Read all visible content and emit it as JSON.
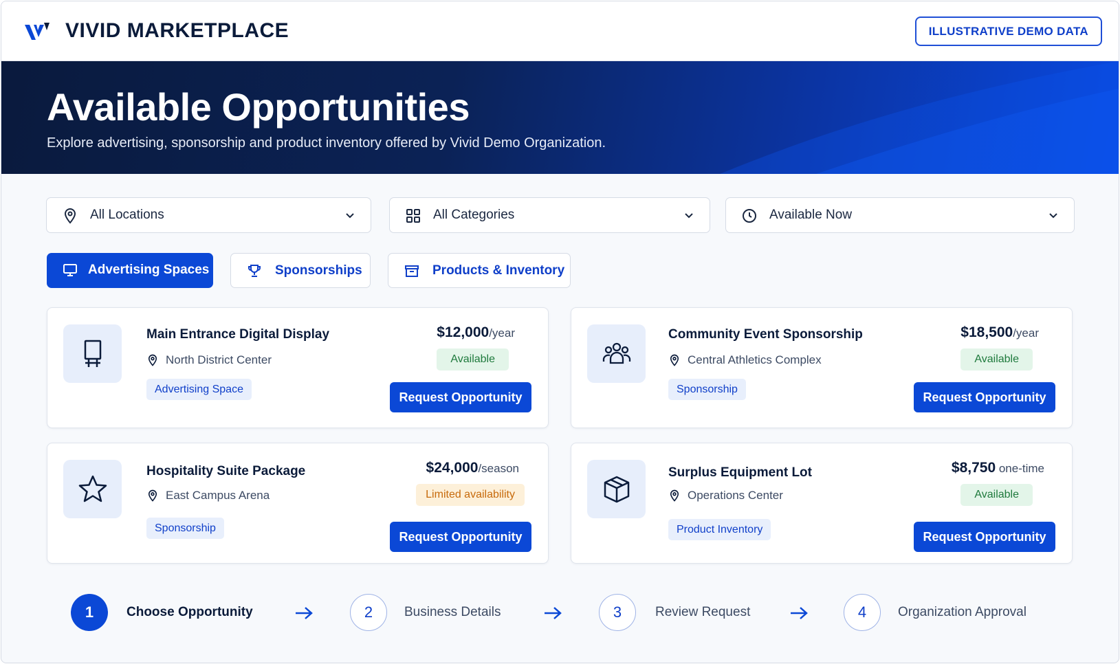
{
  "header": {
    "brand": "VIVID MARKETPLACE",
    "badge": "ILLUSTRATIVE DEMO DATA"
  },
  "hero": {
    "title": "Available Opportunities",
    "subtitle": "Explore advertising, sponsorship and product inventory offered by Vivid Demo Organization."
  },
  "filters": {
    "location": "All Locations",
    "category": "All Categories",
    "availability": "Available Now"
  },
  "tabs": [
    {
      "label": "Advertising Spaces",
      "active": true
    },
    {
      "label": "Sponsorships",
      "active": false
    },
    {
      "label": "Products & Inventory",
      "active": false
    }
  ],
  "cards": [
    {
      "title": "Main Entrance Digital Display",
      "location": "North District Center",
      "tag": "Advertising Space",
      "price": "$12,000",
      "unit": "/year",
      "status": "Available",
      "button": "Request Opportunity",
      "icon": "display-icon"
    },
    {
      "title": "Community Event Sponsorship",
      "location": "Central Athletics Complex",
      "tag": "Sponsorship",
      "price": "$18,500",
      "unit": "/year",
      "status": "Available",
      "button": "Request Opportunity",
      "icon": "people-icon"
    },
    {
      "title": "Hospitality Suite Package",
      "location": "East Campus Arena",
      "tag": "Sponsorship",
      "price": "$24,000",
      "unit": "/season",
      "status": "Limited availability",
      "button": "Request Opportunity",
      "icon": "star-icon"
    },
    {
      "title": "Surplus Equipment Lot",
      "location": "Operations Center",
      "tag": "Product Inventory",
      "price": "$8,750",
      "unit": " one-time",
      "status": "Available",
      "button": "Request Opportunity",
      "icon": "box-icon"
    }
  ],
  "steps": [
    {
      "number": "1",
      "label": "Choose Opportunity",
      "active": true
    },
    {
      "number": "2",
      "label": "Business Details",
      "active": false
    },
    {
      "number": "3",
      "label": "Review Request",
      "active": false
    },
    {
      "number": "4",
      "label": "Organization Approval",
      "active": false
    }
  ],
  "colors": {
    "primary": "#0b48d6",
    "hero_dark": "#0a1a3d",
    "available": "#1f7a3d",
    "limited": "#c76a0b"
  }
}
